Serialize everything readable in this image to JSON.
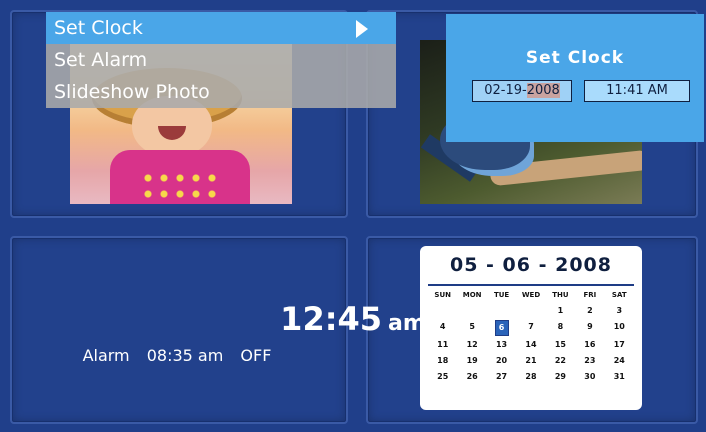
{
  "menu": {
    "items": [
      {
        "label": "Set Clock",
        "active": true
      },
      {
        "label": "Set Alarm",
        "active": false
      },
      {
        "label": "Slideshow Photo",
        "active": false
      }
    ]
  },
  "set_clock": {
    "title": "Set Clock",
    "date_prefix": "02-19-",
    "date_year": "2008",
    "time": "11:41 AM"
  },
  "clock": {
    "time": "12:45",
    "ampm": "am",
    "alarm_label": "Alarm",
    "alarm_time": "08:35 am",
    "alarm_state": "OFF"
  },
  "calendar": {
    "date": "05 - 06 - 2008",
    "weekdays": [
      "SUN",
      "MON",
      "TUE",
      "WED",
      "THU",
      "FRI",
      "SAT"
    ],
    "weeks": [
      [
        "",
        "",
        "",
        "",
        "1",
        "2",
        "3"
      ],
      [
        "4",
        "5",
        "6",
        "7",
        "8",
        "9",
        "10"
      ],
      [
        "11",
        "12",
        "13",
        "14",
        "15",
        "16",
        "17"
      ],
      [
        "18",
        "19",
        "20",
        "21",
        "22",
        "23",
        "24"
      ],
      [
        "25",
        "26",
        "27",
        "28",
        "29",
        "30",
        "31"
      ]
    ],
    "selected_day": "6"
  },
  "colors": {
    "background": "#1e3c86",
    "menu_active": "#4aa6e8",
    "menu_inactive": "#aaaaaa"
  }
}
